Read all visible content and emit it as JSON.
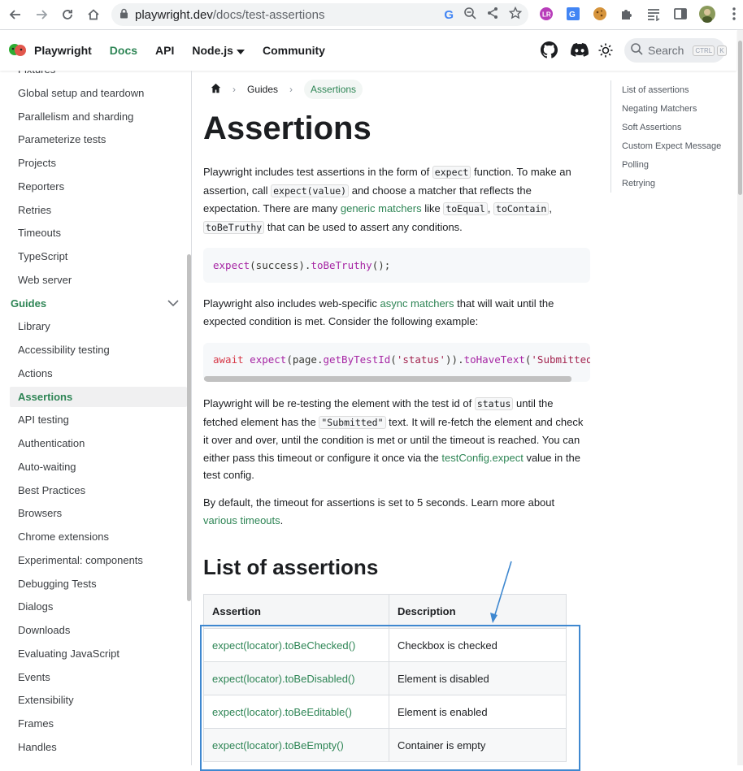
{
  "browser": {
    "url_host": "playwright.dev",
    "url_path": "/docs/test-assertions",
    "icons": [
      "back-arrow",
      "forward-arrow",
      "reload",
      "home",
      "lock",
      "google",
      "zoom-out",
      "share",
      "star",
      "extension-lr",
      "translate",
      "cookie",
      "puzzle",
      "reading-list",
      "sidepanel",
      "profile",
      "menu-dots"
    ]
  },
  "navbar": {
    "brand": "Playwright",
    "links": [
      "Docs",
      "API",
      "Node.js",
      "Community"
    ],
    "search_placeholder": "Search",
    "search_kbd": [
      "CTRL",
      "K"
    ]
  },
  "sidebar": {
    "items": [
      {
        "label": "Fixtures",
        "type": "item"
      },
      {
        "label": "Global setup and teardown",
        "type": "item"
      },
      {
        "label": "Parallelism and sharding",
        "type": "item"
      },
      {
        "label": "Parameterize tests",
        "type": "item"
      },
      {
        "label": "Projects",
        "type": "item"
      },
      {
        "label": "Reporters",
        "type": "item"
      },
      {
        "label": "Retries",
        "type": "item"
      },
      {
        "label": "Timeouts",
        "type": "item"
      },
      {
        "label": "TypeScript",
        "type": "item"
      },
      {
        "label": "Web server",
        "type": "item"
      },
      {
        "label": "Guides",
        "type": "category"
      },
      {
        "label": "Library",
        "type": "item"
      },
      {
        "label": "Accessibility testing",
        "type": "item"
      },
      {
        "label": "Actions",
        "type": "item"
      },
      {
        "label": "Assertions",
        "type": "active"
      },
      {
        "label": "API testing",
        "type": "item"
      },
      {
        "label": "Authentication",
        "type": "item"
      },
      {
        "label": "Auto-waiting",
        "type": "item"
      },
      {
        "label": "Best Practices",
        "type": "item"
      },
      {
        "label": "Browsers",
        "type": "item"
      },
      {
        "label": "Chrome extensions",
        "type": "item"
      },
      {
        "label": "Experimental: components",
        "type": "item"
      },
      {
        "label": "Debugging Tests",
        "type": "item"
      },
      {
        "label": "Dialogs",
        "type": "item"
      },
      {
        "label": "Downloads",
        "type": "item"
      },
      {
        "label": "Evaluating JavaScript",
        "type": "item"
      },
      {
        "label": "Events",
        "type": "item"
      },
      {
        "label": "Extensibility",
        "type": "item"
      },
      {
        "label": "Frames",
        "type": "item"
      },
      {
        "label": "Handles",
        "type": "item"
      }
    ]
  },
  "breadcrumb": {
    "guides": "Guides",
    "current": "Assertions"
  },
  "page": {
    "title": "Assertions",
    "p1": {
      "t1": "Playwright includes test assertions in the form of ",
      "c1": "expect",
      "t2": " function. To make an assertion, call ",
      "c2": "expect(value)",
      "t3": " and choose a matcher that reflects the expectation. There are many ",
      "a1": "generic matchers",
      "t4": " like ",
      "c3": "toEqual",
      "t5": ", ",
      "c4": "toContain",
      "t6": ", ",
      "c5": "toBeTruthy",
      "t7": " that can be used to assert any conditions."
    },
    "code1": {
      "expect": "expect",
      "open": "(success).",
      "method": "toBeTruthy",
      "close": "();"
    },
    "p2": {
      "t1": "Playwright also includes web-specific ",
      "a1": "async matchers",
      "t2": " that will wait until the expected condition is met. Consider the following example:"
    },
    "code2": {
      "await": "await",
      "expect": "expect",
      "p1": "(page.",
      "m1": "getByTestId",
      "p2": "(",
      "s1": "'status'",
      "p3": ")).",
      "m2": "toHaveText",
      "p4": "(",
      "s2": "'Submitted'"
    },
    "p3": {
      "t1": "Playwright will be re-testing the element with the test id of ",
      "c1": "status",
      "t2": " until the fetched element has the ",
      "c2": "\"Submitted\"",
      "t3": " text. It will re-fetch the element and check it over and over, until the condition is met or until the timeout is reached. You can either pass this timeout or configure it once via the ",
      "a1": "testConfig.expect",
      "t4": " value in the test config."
    },
    "p4": {
      "t1": "By default, the timeout for assertions is set to 5 seconds. Learn more about ",
      "a1": "various timeouts",
      "t2": "."
    },
    "h2": "List of assertions",
    "table": {
      "headers": [
        "Assertion",
        "Description"
      ],
      "rows": [
        [
          "expect(locator).toBeChecked()",
          "Checkbox is checked"
        ],
        [
          "expect(locator).toBeDisabled()",
          "Element is disabled"
        ],
        [
          "expect(locator).toBeEditable()",
          "Element is enabled"
        ],
        [
          "expect(locator).toBeEmpty()",
          "Container is empty"
        ]
      ]
    }
  },
  "toc": [
    "List of assertions",
    "Negating Matchers",
    "Soft Assertions",
    "Custom Expect Message",
    "Polling",
    "Retrying"
  ],
  "colors": {
    "accent": "#2e8555",
    "annotation": "#3f88d0"
  }
}
